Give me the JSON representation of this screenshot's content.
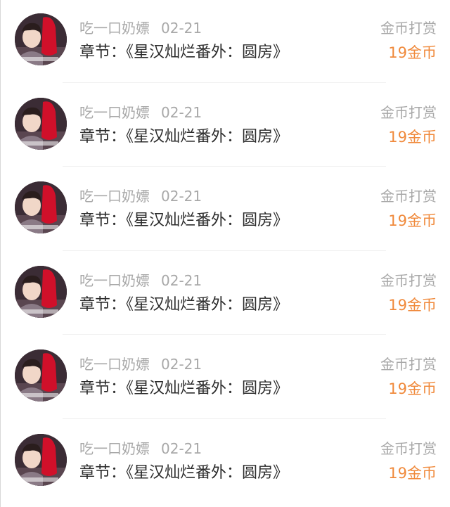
{
  "colors": {
    "name": "#a8a8a8",
    "chapter": "#2b2b2b",
    "amount": "#f08a3c",
    "divider": "#f0f0f0"
  },
  "records": [
    {
      "user": "吃一口奶嫖",
      "date": "02-21",
      "chapter": "章节：《星汉灿烂番外：圆房》",
      "type": "金币打赏",
      "amount": "19金币",
      "avatar": "user-avatar-photo"
    },
    {
      "user": "吃一口奶嫖",
      "date": "02-21",
      "chapter": "章节：《星汉灿烂番外：圆房》",
      "type": "金币打赏",
      "amount": "19金币",
      "avatar": "user-avatar-photo"
    },
    {
      "user": "吃一口奶嫖",
      "date": "02-21",
      "chapter": "章节：《星汉灿烂番外：圆房》",
      "type": "金币打赏",
      "amount": "19金币",
      "avatar": "user-avatar-photo"
    },
    {
      "user": "吃一口奶嫖",
      "date": "02-21",
      "chapter": "章节：《星汉灿烂番外：圆房》",
      "type": "金币打赏",
      "amount": "19金币",
      "avatar": "user-avatar-photo"
    },
    {
      "user": "吃一口奶嫖",
      "date": "02-21",
      "chapter": "章节：《星汉灿烂番外：圆房》",
      "type": "金币打赏",
      "amount": "19金币",
      "avatar": "user-avatar-photo"
    },
    {
      "user": "吃一口奶嫖",
      "date": "02-21",
      "chapter": "章节：《星汉灿烂番外：圆房》",
      "type": "金币打赏",
      "amount": "19金币",
      "avatar": "user-avatar-photo"
    }
  ]
}
